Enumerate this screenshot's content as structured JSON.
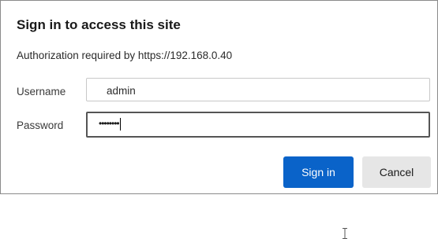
{
  "dialog": {
    "title": "Sign in to access this site",
    "subtitle": "Authorization required by https://192.168.0.40"
  },
  "fields": {
    "username": {
      "label": "Username",
      "value": "admin"
    },
    "password": {
      "label": "Password",
      "masked_value": "••••••••"
    }
  },
  "buttons": {
    "sign_in": "Sign in",
    "cancel": "Cancel"
  },
  "colors": {
    "primary": "#0a63c9",
    "secondary": "#e6e6e6"
  },
  "icons": {
    "cursor": "text-ibeam-cursor-icon"
  }
}
